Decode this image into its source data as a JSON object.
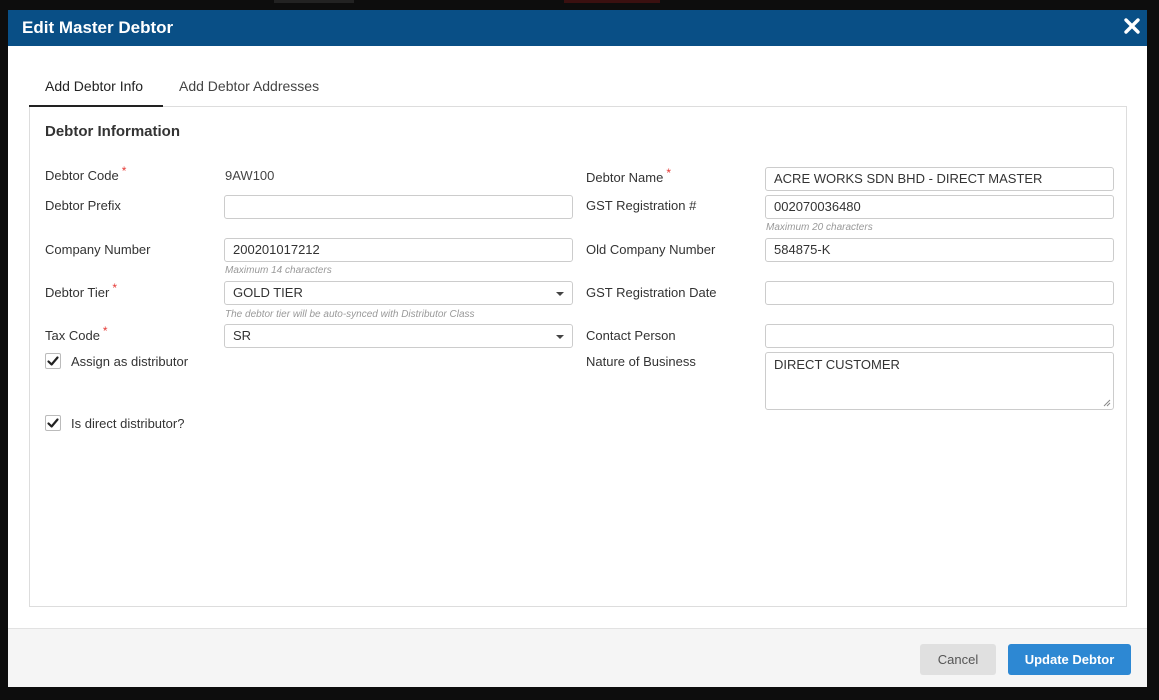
{
  "modal": {
    "title": "Edit Master Debtor",
    "close_icon": "close-icon"
  },
  "tabs": [
    {
      "label": "Add Debtor Info",
      "active": true
    },
    {
      "label": "Add Debtor Addresses",
      "active": false
    }
  ],
  "section": {
    "title": "Debtor Information"
  },
  "left": {
    "debtor_code": {
      "label": "Debtor Code",
      "value": "9AW100",
      "required_mark": "*"
    },
    "debtor_prefix": {
      "label": "Debtor Prefix",
      "value": ""
    },
    "company_number": {
      "label": "Company Number",
      "value": "200201017212",
      "hint": "Maximum 14 characters"
    },
    "debtor_tier": {
      "label": "Debtor Tier",
      "value": "GOLD TIER",
      "required_mark": "*",
      "hint": "The debtor tier will be auto-synced with Distributor Class"
    },
    "tax_code": {
      "label": "Tax Code",
      "value": "SR",
      "required_mark": "*"
    },
    "assign_distributor": {
      "label": "Assign as distributor",
      "checked": true
    },
    "direct_distributor": {
      "label": "Is direct distributor?",
      "checked": true
    }
  },
  "right": {
    "debtor_name": {
      "label": "Debtor Name",
      "value": "ACRE WORKS SDN BHD - DIRECT MASTER",
      "required_mark": "*"
    },
    "gst_registration": {
      "label": "GST Registration #",
      "value": "002070036480",
      "hint": "Maximum 20 characters"
    },
    "old_company_number": {
      "label": "Old Company Number",
      "value": "584875-K"
    },
    "gst_registration_date": {
      "label": "GST Registration Date",
      "value": ""
    },
    "contact_person": {
      "label": "Contact Person",
      "value": ""
    },
    "nature_of_business": {
      "label": "Nature of Business",
      "value": "DIRECT CUSTOMER"
    }
  },
  "footer": {
    "cancel_label": "Cancel",
    "update_label": "Update Debtor"
  },
  "colors": {
    "header": "#094f86",
    "primary": "#2d88d3",
    "required": "#e53935"
  }
}
